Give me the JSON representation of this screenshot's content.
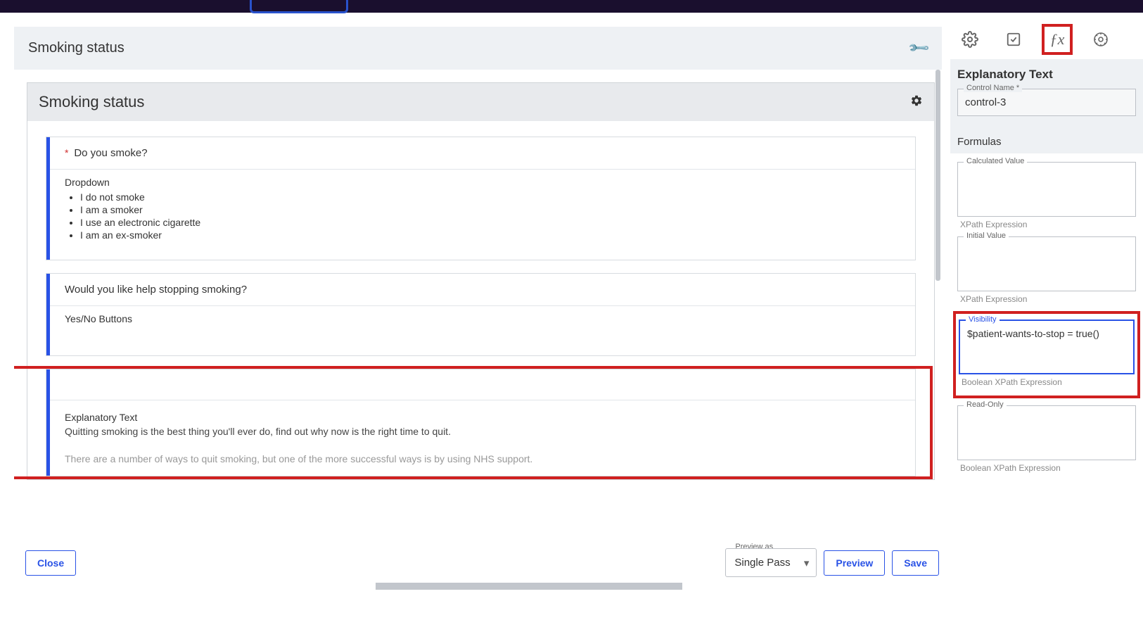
{
  "header": {
    "outer_title": "Smoking status",
    "section_title": "Smoking status"
  },
  "fields": {
    "smoke_q": {
      "label": "Do you smoke?",
      "type": "Dropdown",
      "options": [
        "I do not smoke",
        "I am a smoker",
        "I use an electronic cigarette",
        "I am an ex-smoker"
      ]
    },
    "help_q": {
      "label": "Would you like help stopping smoking?",
      "type": "Yes/No Buttons"
    },
    "expl": {
      "type": "Explanatory Text",
      "text": "Quitting smoking is the best thing you'll ever do, find out why now is the right time to quit.",
      "text2": "There are a number of ways to quit smoking, but one of the more successful ways is by using NHS support."
    }
  },
  "footer": {
    "close": "Close",
    "preview_as_label": "Preview as",
    "preview_as_value": "Single Pass",
    "preview": "Preview",
    "save": "Save"
  },
  "sidebar": {
    "panel_title": "Explanatory Text",
    "control_name_label": "Control Name *",
    "control_name_value": "control-3",
    "formulas_title": "Formulas",
    "calc_label": "Calculated Value",
    "calc_help": "XPath Expression",
    "init_label": "Initial Value",
    "init_help": "XPath Expression",
    "vis_label": "Visibility",
    "vis_value": "$patient-wants-to-stop = true()",
    "vis_help": "Boolean XPath Expression",
    "ro_label": "Read-Only",
    "ro_help": "Boolean XPath Expression"
  }
}
